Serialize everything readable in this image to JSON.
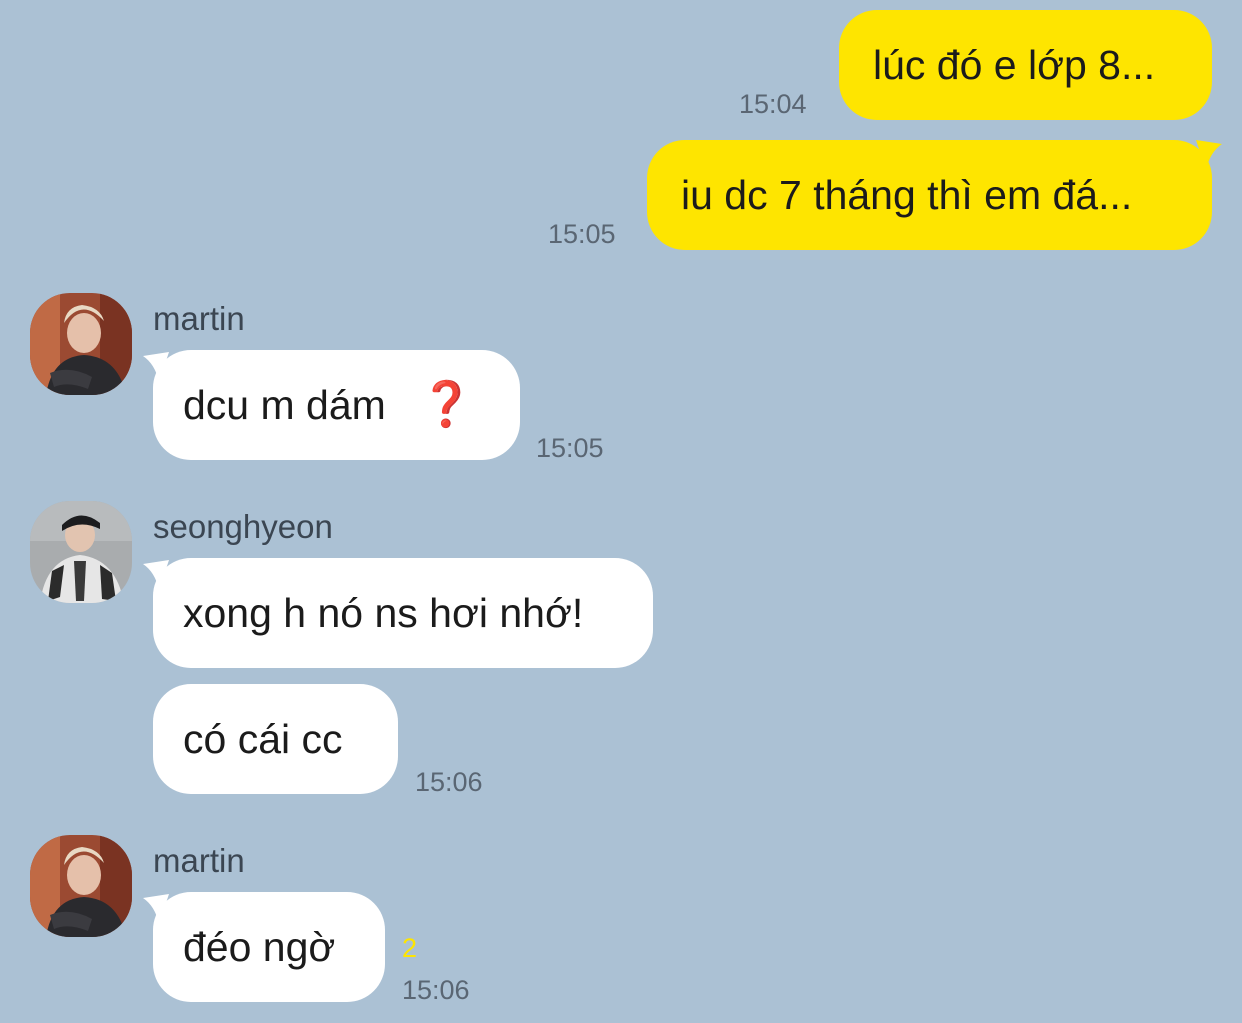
{
  "messages": [
    {
      "text": "lúc đó e lớp 8...",
      "time": "15:04"
    },
    {
      "text": "iu dc 7 tháng thì em đá...",
      "time": "15:05"
    },
    {
      "sender": "martin",
      "text": "dcu m dám ",
      "reaction": "❓",
      "time": "15:05"
    },
    {
      "sender": "seonghyeon",
      "text": "xong h nó ns hơi nhớ!"
    },
    {
      "text": "có cái cc",
      "time": "15:06"
    },
    {
      "sender": "martin",
      "text": "đéo ngờ",
      "unread": "2",
      "time": "15:06"
    }
  ],
  "colors": {
    "background": "#abc1d4",
    "outgoing_bubble": "#fee500",
    "incoming_bubble": "#ffffff",
    "unread_count": "#fee500",
    "question_mark": "#d0021b"
  }
}
